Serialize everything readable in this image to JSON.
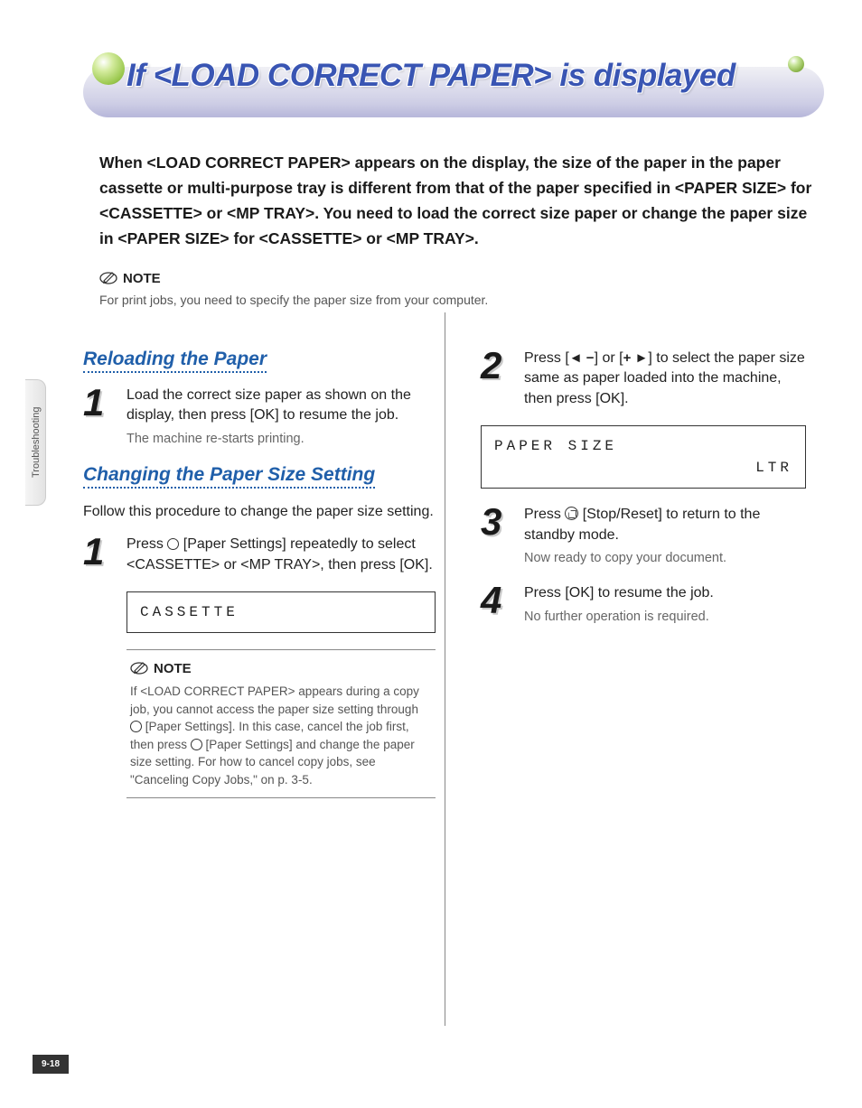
{
  "side_tab": "Troubleshooting",
  "page_number": "9-18",
  "title": "If <LOAD CORRECT PAPER> is displayed",
  "intro": "When <LOAD CORRECT PAPER> appears on the display, the size of the paper in the paper cassette or multi-purpose tray is different from that of the paper specified in <PAPER SIZE> for <CASSETTE> or <MP TRAY>. You need to load the correct size paper or change the paper size in <PAPER SIZE> for <CASSETTE> or <MP TRAY>.",
  "top_note_label": "NOTE",
  "top_note_body": "For print jobs, you need to specify the paper size from your computer.",
  "sections": {
    "reloading": {
      "heading": "Reloading the Paper",
      "step1": {
        "num": "1",
        "body": "Load the correct size paper as shown on the display, then press [OK] to resume the job.",
        "sub": "The machine re-starts printing."
      }
    },
    "changing": {
      "heading": "Changing the Paper Size Setting",
      "intro": "Follow this procedure to change the paper size setting.",
      "step1": {
        "num": "1",
        "body_pre": "Press ",
        "body_post": " [Paper Settings] repeatedly to select <CASSETTE> or <MP TRAY>, then press [OK].",
        "lcd": "CASSETTE"
      },
      "note_label": "NOTE",
      "note_body_pre": "If <LOAD CORRECT PAPER> appears during a copy job, you cannot access the paper size setting through ",
      "note_body_mid": " [Paper Settings]. In this case, cancel the job first, then press ",
      "note_body_post": " [Paper Settings] and change the paper size setting. For how to cancel copy jobs, see \"Canceling Copy Jobs,\" on p. 3-5.",
      "step2": {
        "num": "2",
        "body_pre": "Press [",
        "body_mid": "] or [",
        "body_post": "] to select the paper size same as paper loaded into the machine, then press [OK].",
        "lcd_line1": "PAPER SIZE",
        "lcd_line2": "LTR"
      },
      "step3": {
        "num": "3",
        "body_pre": "Press ",
        "body_post": " [Stop/Reset] to return to the standby mode.",
        "sub": "Now ready to copy your document."
      },
      "step4": {
        "num": "4",
        "body": "Press [OK] to resume the job.",
        "sub": "No further operation is required."
      }
    }
  }
}
